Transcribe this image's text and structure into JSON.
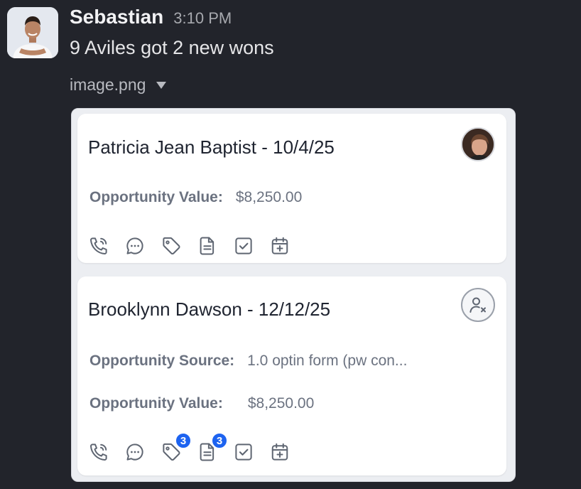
{
  "message": {
    "sender": "Sebastian",
    "time": "3:10 PM",
    "text": "9 Aviles got 2 new wons",
    "attachment": {
      "name": "image.png",
      "icon": "caret-down-icon"
    }
  },
  "cards": [
    {
      "title": "Patricia Jean Baptist - 10/4/25",
      "avatar": "contact-photo",
      "fields": [
        {
          "label": "Opportunity Value:",
          "value": "$8,250.00"
        }
      ],
      "actions": [
        {
          "icon": "phone-icon"
        },
        {
          "icon": "chat-icon"
        },
        {
          "icon": "tag-icon"
        },
        {
          "icon": "note-icon"
        },
        {
          "icon": "task-icon"
        },
        {
          "icon": "calendar-add-icon"
        }
      ]
    },
    {
      "title": "Brooklynn Dawson - 12/12/25",
      "avatar": "unassigned-user-icon",
      "fields": [
        {
          "label": "Opportunity Source:",
          "value": "1.0 optin form (pw con..."
        },
        {
          "label": "Opportunity Value:",
          "value": "$8,250.00"
        }
      ],
      "actions": [
        {
          "icon": "phone-icon"
        },
        {
          "icon": "chat-icon"
        },
        {
          "icon": "tag-icon",
          "badge": "3"
        },
        {
          "icon": "note-icon",
          "badge": "3"
        },
        {
          "icon": "task-icon"
        },
        {
          "icon": "calendar-add-icon"
        }
      ]
    }
  ],
  "colors": {
    "background": "#22242b",
    "badge": "#1d63f0",
    "icon": "#5f6672"
  }
}
